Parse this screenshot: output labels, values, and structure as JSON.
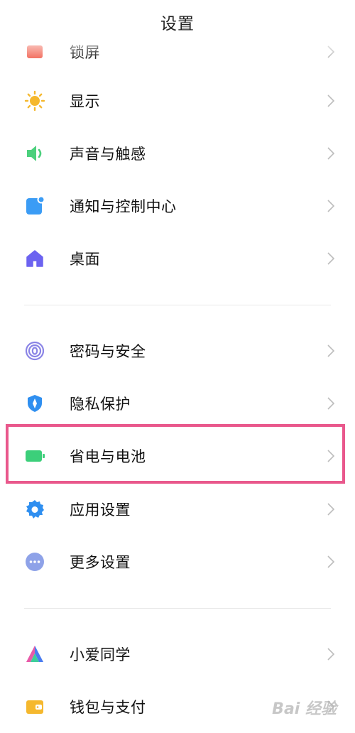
{
  "header": {
    "title": "设置"
  },
  "items": [
    {
      "label": "锁屏",
      "icon": "lock-screen-icon",
      "color": "#f26b5b"
    },
    {
      "label": "显示",
      "icon": "sun-icon",
      "color": "#f5b82e"
    },
    {
      "label": "声音与触感",
      "icon": "speaker-icon",
      "color": "#4cd07d"
    },
    {
      "label": "通知与控制中心",
      "icon": "notification-icon",
      "color": "#3b9cf5"
    },
    {
      "label": "桌面",
      "icon": "home-icon",
      "color": "#6c63f0"
    },
    {
      "label": "密码与安全",
      "icon": "fingerprint-icon",
      "color": "#8a84e6"
    },
    {
      "label": "隐私保护",
      "icon": "privacy-shield-icon",
      "color": "#2f8ff0"
    },
    {
      "label": "省电与电池",
      "icon": "battery-icon",
      "color": "#3ccf7a"
    },
    {
      "label": "应用设置",
      "icon": "gear-icon",
      "color": "#2f8ff0"
    },
    {
      "label": "更多设置",
      "icon": "more-icon",
      "color": "#8ea2e8"
    },
    {
      "label": "小爱同学",
      "icon": "xiaoai-icon",
      "color": "#4a7cf0"
    },
    {
      "label": "钱包与支付",
      "icon": "wallet-icon",
      "color": "#f5b82e"
    }
  ],
  "watermark": {
    "text": "Bai 经验"
  }
}
